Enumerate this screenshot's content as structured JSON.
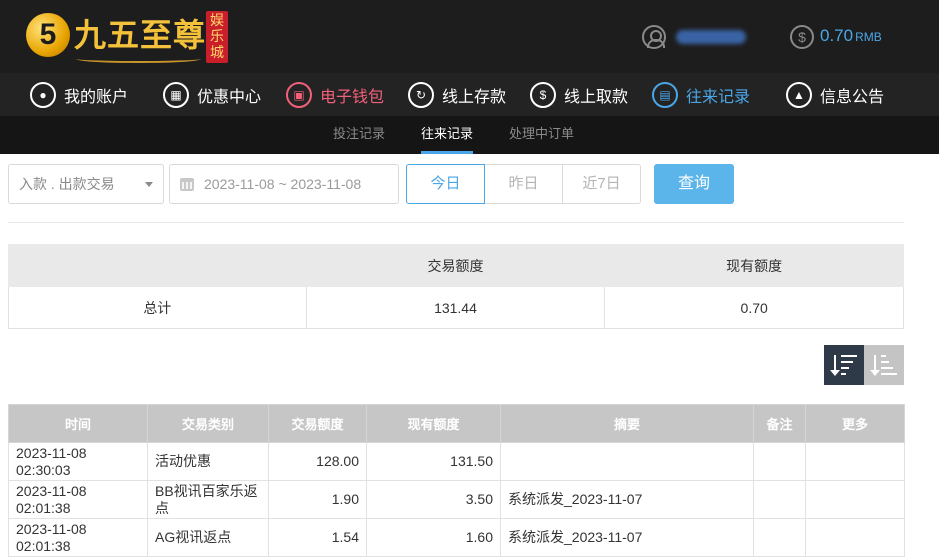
{
  "header": {
    "logo_mark": "5",
    "brand": "九五至尊",
    "brand_tag": "娱乐城",
    "balance_value": "0.70",
    "balance_unit": "RMB"
  },
  "nav": [
    {
      "label": "我的账户",
      "icon": "user-icon"
    },
    {
      "label": "优惠中心",
      "icon": "gift-icon"
    },
    {
      "label": "电子钱包",
      "icon": "wallet-icon"
    },
    {
      "label": "线上存款",
      "icon": "deposit-icon"
    },
    {
      "label": "线上取款",
      "icon": "withdraw-icon"
    },
    {
      "label": "往来记录",
      "icon": "records-icon"
    },
    {
      "label": "信息公告",
      "icon": "bell-icon"
    }
  ],
  "subnav": [
    {
      "label": "投注记录"
    },
    {
      "label": "往来记录"
    },
    {
      "label": "处理中订单"
    }
  ],
  "filters": {
    "type_value": "入款 . 出款交易",
    "date_range": "2023-11-08 ~ 2023-11-08",
    "today": "今日",
    "yesterday": "昨日",
    "last7": "近7日",
    "query": "查询"
  },
  "summary": {
    "col_amount": "交易额度",
    "col_balance": "现有额度",
    "row_label": "总计",
    "amount": "131.44",
    "balance": "0.70"
  },
  "records": {
    "headers": [
      "时间",
      "交易类别",
      "交易额度",
      "现有额度",
      "摘要",
      "备注",
      "更多"
    ],
    "rows": [
      [
        "2023-11-08 02:30:03",
        "活动优惠",
        "128.00",
        "131.50",
        "",
        "",
        ""
      ],
      [
        "2023-11-08 02:01:38",
        "BB视讯百家乐返点",
        "1.90",
        "3.50",
        "系统派发_2023-11-07",
        "",
        ""
      ],
      [
        "2023-11-08 02:01:38",
        "AG视讯返点",
        "1.54",
        "1.60",
        "系统派发_2023-11-07",
        "",
        ""
      ]
    ]
  },
  "colors": {
    "accent": "#4aa6e8",
    "wallet_red": "#f1607a",
    "header_bg": "#1d1d1d",
    "gold": "#f3c13a"
  }
}
